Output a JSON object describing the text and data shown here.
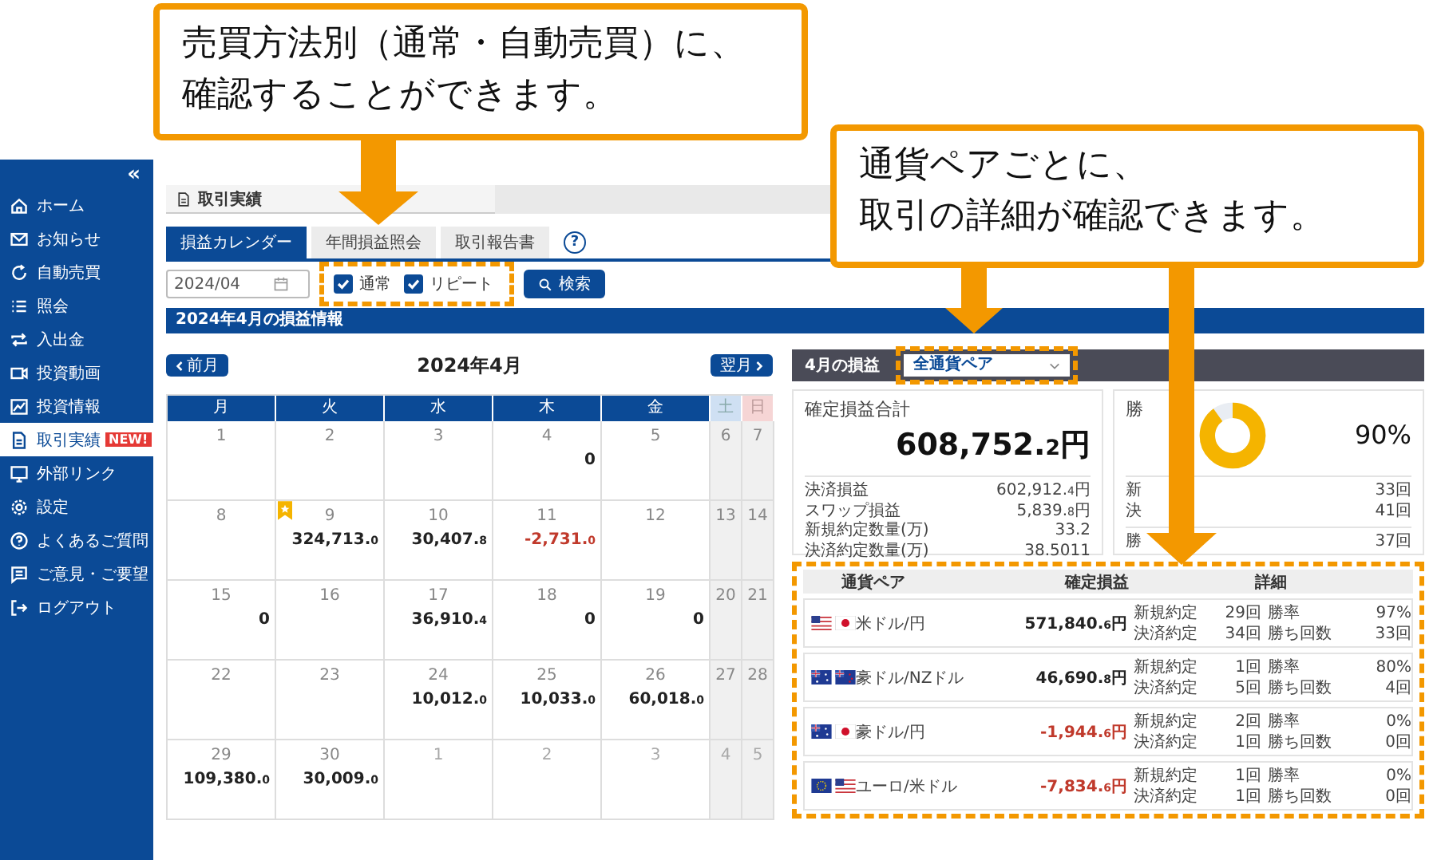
{
  "callouts": [
    {
      "lines": [
        "売買方法別（通常・自動売買）に、",
        "確認することができます。"
      ]
    },
    {
      "lines": [
        "通貨ペアごとに、",
        "取引の詳細が確認できます。"
      ]
    }
  ],
  "sidebar": {
    "collapse": "«",
    "items": [
      {
        "label": "ホーム",
        "selected": false
      },
      {
        "label": "お知らせ",
        "selected": false
      },
      {
        "label": "自動売買",
        "selected": false
      },
      {
        "label": "照会",
        "selected": false
      },
      {
        "label": "入出金",
        "selected": false
      },
      {
        "label": "投資動画",
        "selected": false
      },
      {
        "label": "投資情報",
        "selected": false
      },
      {
        "label": "取引実績",
        "selected": true,
        "badge": "NEW!"
      },
      {
        "label": "外部リンク",
        "selected": false
      },
      {
        "label": "設定",
        "selected": false
      },
      {
        "label": "よくあるご質問",
        "selected": false
      },
      {
        "label": "ご意見・ご要望",
        "selected": false
      },
      {
        "label": "ログアウト",
        "selected": false
      }
    ]
  },
  "page_title": "取引実績",
  "tabs": [
    {
      "label": "損益カレンダー",
      "selected": true
    },
    {
      "label": "年間損益照会",
      "selected": false
    },
    {
      "label": "取引報告書",
      "selected": false
    }
  ],
  "help": "?",
  "filter": {
    "month": "2024/04",
    "checkboxes": [
      {
        "label": "通常",
        "checked": true
      },
      {
        "label": "リピート",
        "checked": true
      }
    ],
    "search": "検索"
  },
  "section_title": "2024年4月の損益情報",
  "calendar": {
    "prev": "前月",
    "title": "2024年4月",
    "next": "翌月",
    "weekdays": [
      {
        "label": "月",
        "kind": "weekday"
      },
      {
        "label": "火",
        "kind": "weekday"
      },
      {
        "label": "水",
        "kind": "weekday"
      },
      {
        "label": "木",
        "kind": "weekday"
      },
      {
        "label": "金",
        "kind": "weekday"
      },
      {
        "label": "土",
        "kind": "sat"
      },
      {
        "label": "日",
        "kind": "sun"
      }
    ],
    "weeks": [
      [
        {
          "day": "1"
        },
        {
          "day": "2"
        },
        {
          "day": "3"
        },
        {
          "day": "4",
          "amount": "0"
        },
        {
          "day": "5"
        },
        {
          "day": "6"
        },
        {
          "day": "7"
        }
      ],
      [
        {
          "day": "8"
        },
        {
          "day": "9",
          "amount": "324,713.0",
          "ribbon": true
        },
        {
          "day": "10",
          "amount": "30,407.8"
        },
        {
          "day": "11",
          "amount": "-2,731.0",
          "loss": true
        },
        {
          "day": "12"
        },
        {
          "day": "13"
        },
        {
          "day": "14"
        }
      ],
      [
        {
          "day": "15",
          "amount": "0"
        },
        {
          "day": "16"
        },
        {
          "day": "17",
          "amount": "36,910.4"
        },
        {
          "day": "18",
          "amount": "0"
        },
        {
          "day": "19",
          "amount": "0"
        },
        {
          "day": "20"
        },
        {
          "day": "21"
        }
      ],
      [
        {
          "day": "22"
        },
        {
          "day": "23"
        },
        {
          "day": "24",
          "amount": "10,012.0"
        },
        {
          "day": "25",
          "amount": "10,033.0"
        },
        {
          "day": "26",
          "amount": "60,018.0"
        },
        {
          "day": "27"
        },
        {
          "day": "28"
        }
      ],
      [
        {
          "day": "29",
          "amount": "109,380.0"
        },
        {
          "day": "30",
          "amount": "30,009.0"
        },
        {
          "day": "1",
          "other_month": true
        },
        {
          "day": "2",
          "other_month": true
        },
        {
          "day": "3",
          "other_month": true
        },
        {
          "day": "4",
          "other_month": true
        },
        {
          "day": "5",
          "other_month": true
        }
      ]
    ]
  },
  "monthly": {
    "header": "4月の損益",
    "pair_select": "全通貨ペア",
    "total_label": "確定損益合計",
    "total": "608,752.2円",
    "stats": [
      {
        "label": "決済損益",
        "value": "602,912.4円"
      },
      {
        "label": "スワップ損益",
        "value": "5,839.8円"
      },
      {
        "label": "新規約定数量(万)",
        "value": "33.2"
      },
      {
        "label": "決済約定数量(万)",
        "value": "38.5011"
      }
    ],
    "win": {
      "label": "勝",
      "level": 0.9,
      "rate": "90%",
      "counts": [
        {
          "label": "新",
          "value": "33回"
        },
        {
          "label": "決",
          "value": "41回"
        }
      ],
      "wins": {
        "label": "勝",
        "value": "37回"
      }
    }
  },
  "pairs": {
    "columns": [
      "通貨ペア",
      "確定損益",
      "詳細"
    ],
    "rows": [
      {
        "pair": "米ドル/円",
        "profit": "571,840.6円",
        "loss": false,
        "details": [
          [
            "新規約定",
            "29回",
            "勝率",
            "97%"
          ],
          [
            "決済約定",
            "34回",
            "勝ち回数",
            "33回"
          ]
        ]
      },
      {
        "pair": "豪ドル/NZドル",
        "profit": "46,690.8円",
        "loss": false,
        "details": [
          [
            "新規約定",
            "1回",
            "勝率",
            "80%"
          ],
          [
            "決済約定",
            "5回",
            "勝ち回数",
            "4回"
          ]
        ]
      },
      {
        "pair": "豪ドル/円",
        "profit": "-1,944.6円",
        "loss": true,
        "details": [
          [
            "新規約定",
            "2回",
            "勝率",
            "0%"
          ],
          [
            "決済約定",
            "1回",
            "勝ち回数",
            "0回"
          ]
        ]
      },
      {
        "pair": "ユーロ/米ドル",
        "profit": "-7,834.6円",
        "loss": true,
        "details": [
          [
            "新規約定",
            "1回",
            "勝率",
            "0%"
          ],
          [
            "決済約定",
            "1回",
            "勝ち回数",
            "0回"
          ]
        ]
      }
    ]
  }
}
